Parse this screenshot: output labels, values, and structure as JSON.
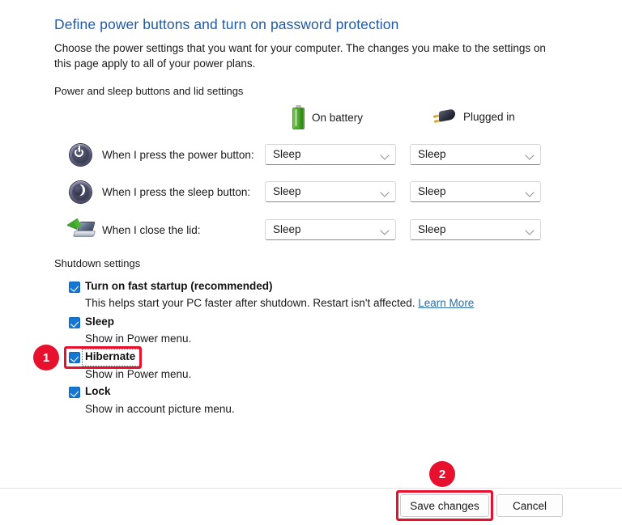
{
  "heading": "Define power buttons and turn on password protection",
  "intro": "Choose the power settings that you want for your computer. The changes you make to the settings on this page apply to all of your power plans.",
  "groups": {
    "power_sleep_lid": "Power and sleep buttons and lid settings",
    "shutdown": "Shutdown settings"
  },
  "columns": [
    {
      "label": "On battery",
      "icon": "battery-icon"
    },
    {
      "label": "Plugged in",
      "icon": "power-plug-icon"
    }
  ],
  "settings_rows": [
    {
      "icon": "power-button-icon",
      "label": "When I press the power button:",
      "on_battery": "Sleep",
      "plugged_in": "Sleep"
    },
    {
      "icon": "sleep-moon-icon",
      "label": "When I press the sleep button:",
      "on_battery": "Sleep",
      "plugged_in": "Sleep"
    },
    {
      "icon": "laptop-lid-icon",
      "label": "When I close the lid:",
      "on_battery": "Sleep",
      "plugged_in": "Sleep"
    }
  ],
  "shutdown_options": [
    {
      "label": "Turn on fast startup (recommended)",
      "checked": true,
      "description": "This helps start your PC faster after shutdown. Restart isn't affected.",
      "link": "Learn More"
    },
    {
      "label": "Sleep",
      "checked": true,
      "description": "Show in Power menu.",
      "link": ""
    },
    {
      "label": "Hibernate",
      "checked": true,
      "description": "Show in Power menu.",
      "link": ""
    },
    {
      "label": "Lock",
      "checked": true,
      "description": "Show in account picture menu.",
      "link": ""
    }
  ],
  "footer": {
    "save_label": "Save changes",
    "cancel_label": "Cancel"
  },
  "annotations": [
    {
      "number": "1",
      "target": "hibernate-checkbox"
    },
    {
      "number": "2",
      "target": "save-changes-button"
    }
  ],
  "colors": {
    "heading_blue": "#1f5ba8",
    "checkbox_blue": "#1577d2",
    "annotation_red": "#e8112d",
    "link_blue": "#2f6ca8"
  }
}
